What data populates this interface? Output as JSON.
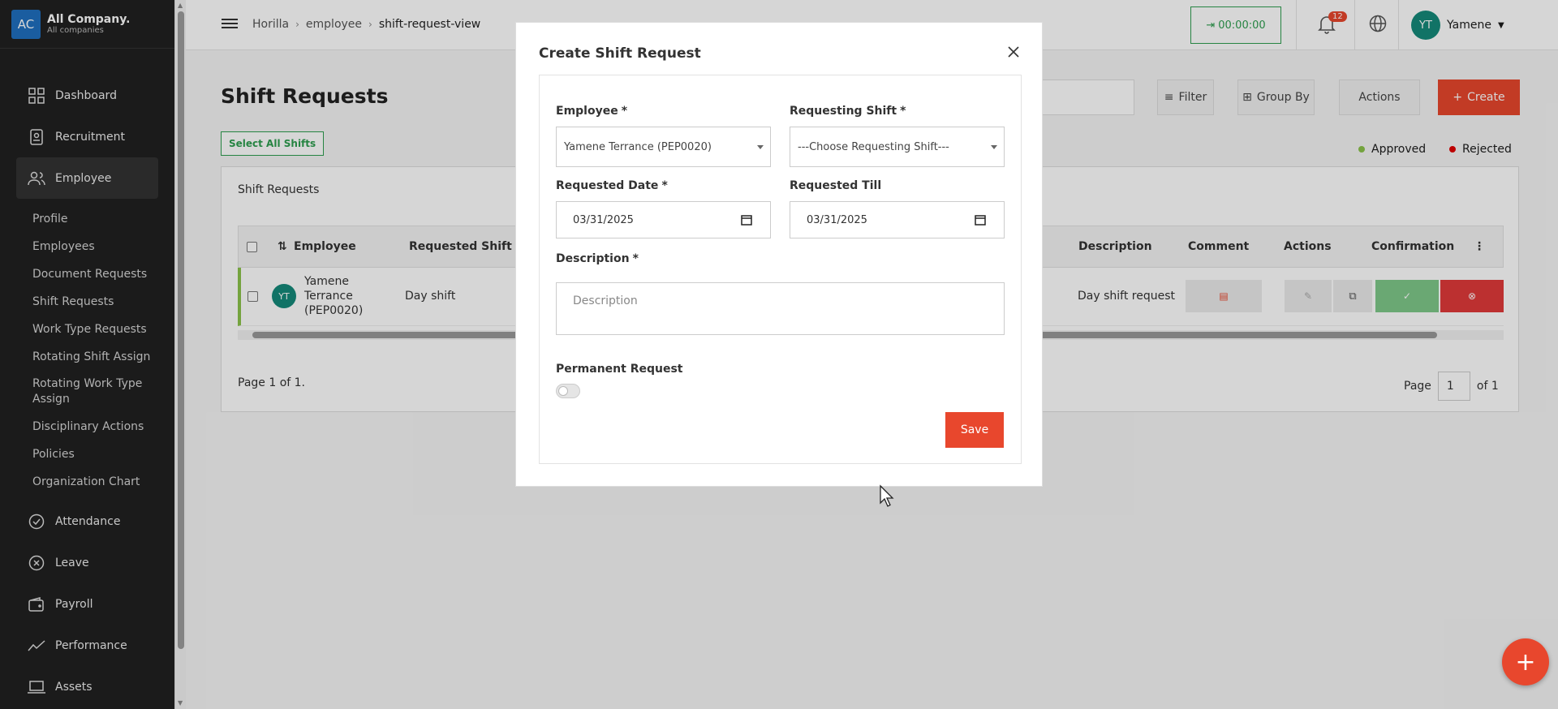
{
  "company": {
    "initials": "AC",
    "name": "All Company.",
    "sub": "All companies"
  },
  "nav": {
    "dashboard": "Dashboard",
    "recruitment": "Recruitment",
    "employee": "Employee",
    "sub": [
      "Profile",
      "Employees",
      "Document Requests",
      "Shift Requests",
      "Work Type Requests",
      "Rotating Shift Assign",
      "Rotating Work Type Assign",
      "Disciplinary Actions",
      "Policies",
      "Organization Chart"
    ],
    "attendance": "Attendance",
    "leave": "Leave",
    "payroll": "Payroll",
    "performance": "Performance",
    "assets": "Assets"
  },
  "header": {
    "crumbs": [
      "Horilla",
      "employee",
      "shift-request-view"
    ],
    "timer": "00:00:00",
    "notif_count": "12",
    "user_initials": "YT",
    "user_name": "Yamene"
  },
  "page": {
    "title": "Shift Requests",
    "filter": "Filter",
    "group_by": "Group By",
    "actions": "Actions",
    "create": "Create",
    "select_all": "Select All Shifts",
    "legend_approved": "Approved",
    "legend_rejected": "Rejected",
    "legend_colors": {
      "approved": "#8bc34a",
      "rejected": "#e00000"
    },
    "panel_title": "Shift Requests"
  },
  "table": {
    "headers": {
      "employee": "Employee",
      "requested_shift": "Requested Shift",
      "description": "Description",
      "comment": "Comment",
      "actions": "Actions",
      "confirmation": "Confirmation"
    },
    "row": {
      "initials": "YT",
      "name_l1": "Yamene",
      "name_l2": "Terrance",
      "name_l3": "(PEP0020)",
      "shift": "Day shift",
      "description": "Day shift request"
    }
  },
  "pagination": {
    "left": "Page 1 of 1.",
    "page_label": "Page",
    "page_value": "1",
    "of_label": "of 1"
  },
  "modal": {
    "title": "Create Shift Request",
    "employee_label": "Employee",
    "employee_value": "Yamene Terrance (PEP0020)",
    "shift_label": "Requesting Shift",
    "shift_placeholder": "---Choose Requesting Shift---",
    "req_date_label": "Requested Date",
    "req_date_value": "03/31/2025",
    "req_till_label": "Requested Till",
    "req_till_value": "03/31/2025",
    "desc_label": "Description",
    "desc_placeholder": "Description",
    "permanent_label": "Permanent Request",
    "save": "Save",
    "required_mark": "*"
  },
  "accent": "#e8472d",
  "fab_symbol": "+"
}
